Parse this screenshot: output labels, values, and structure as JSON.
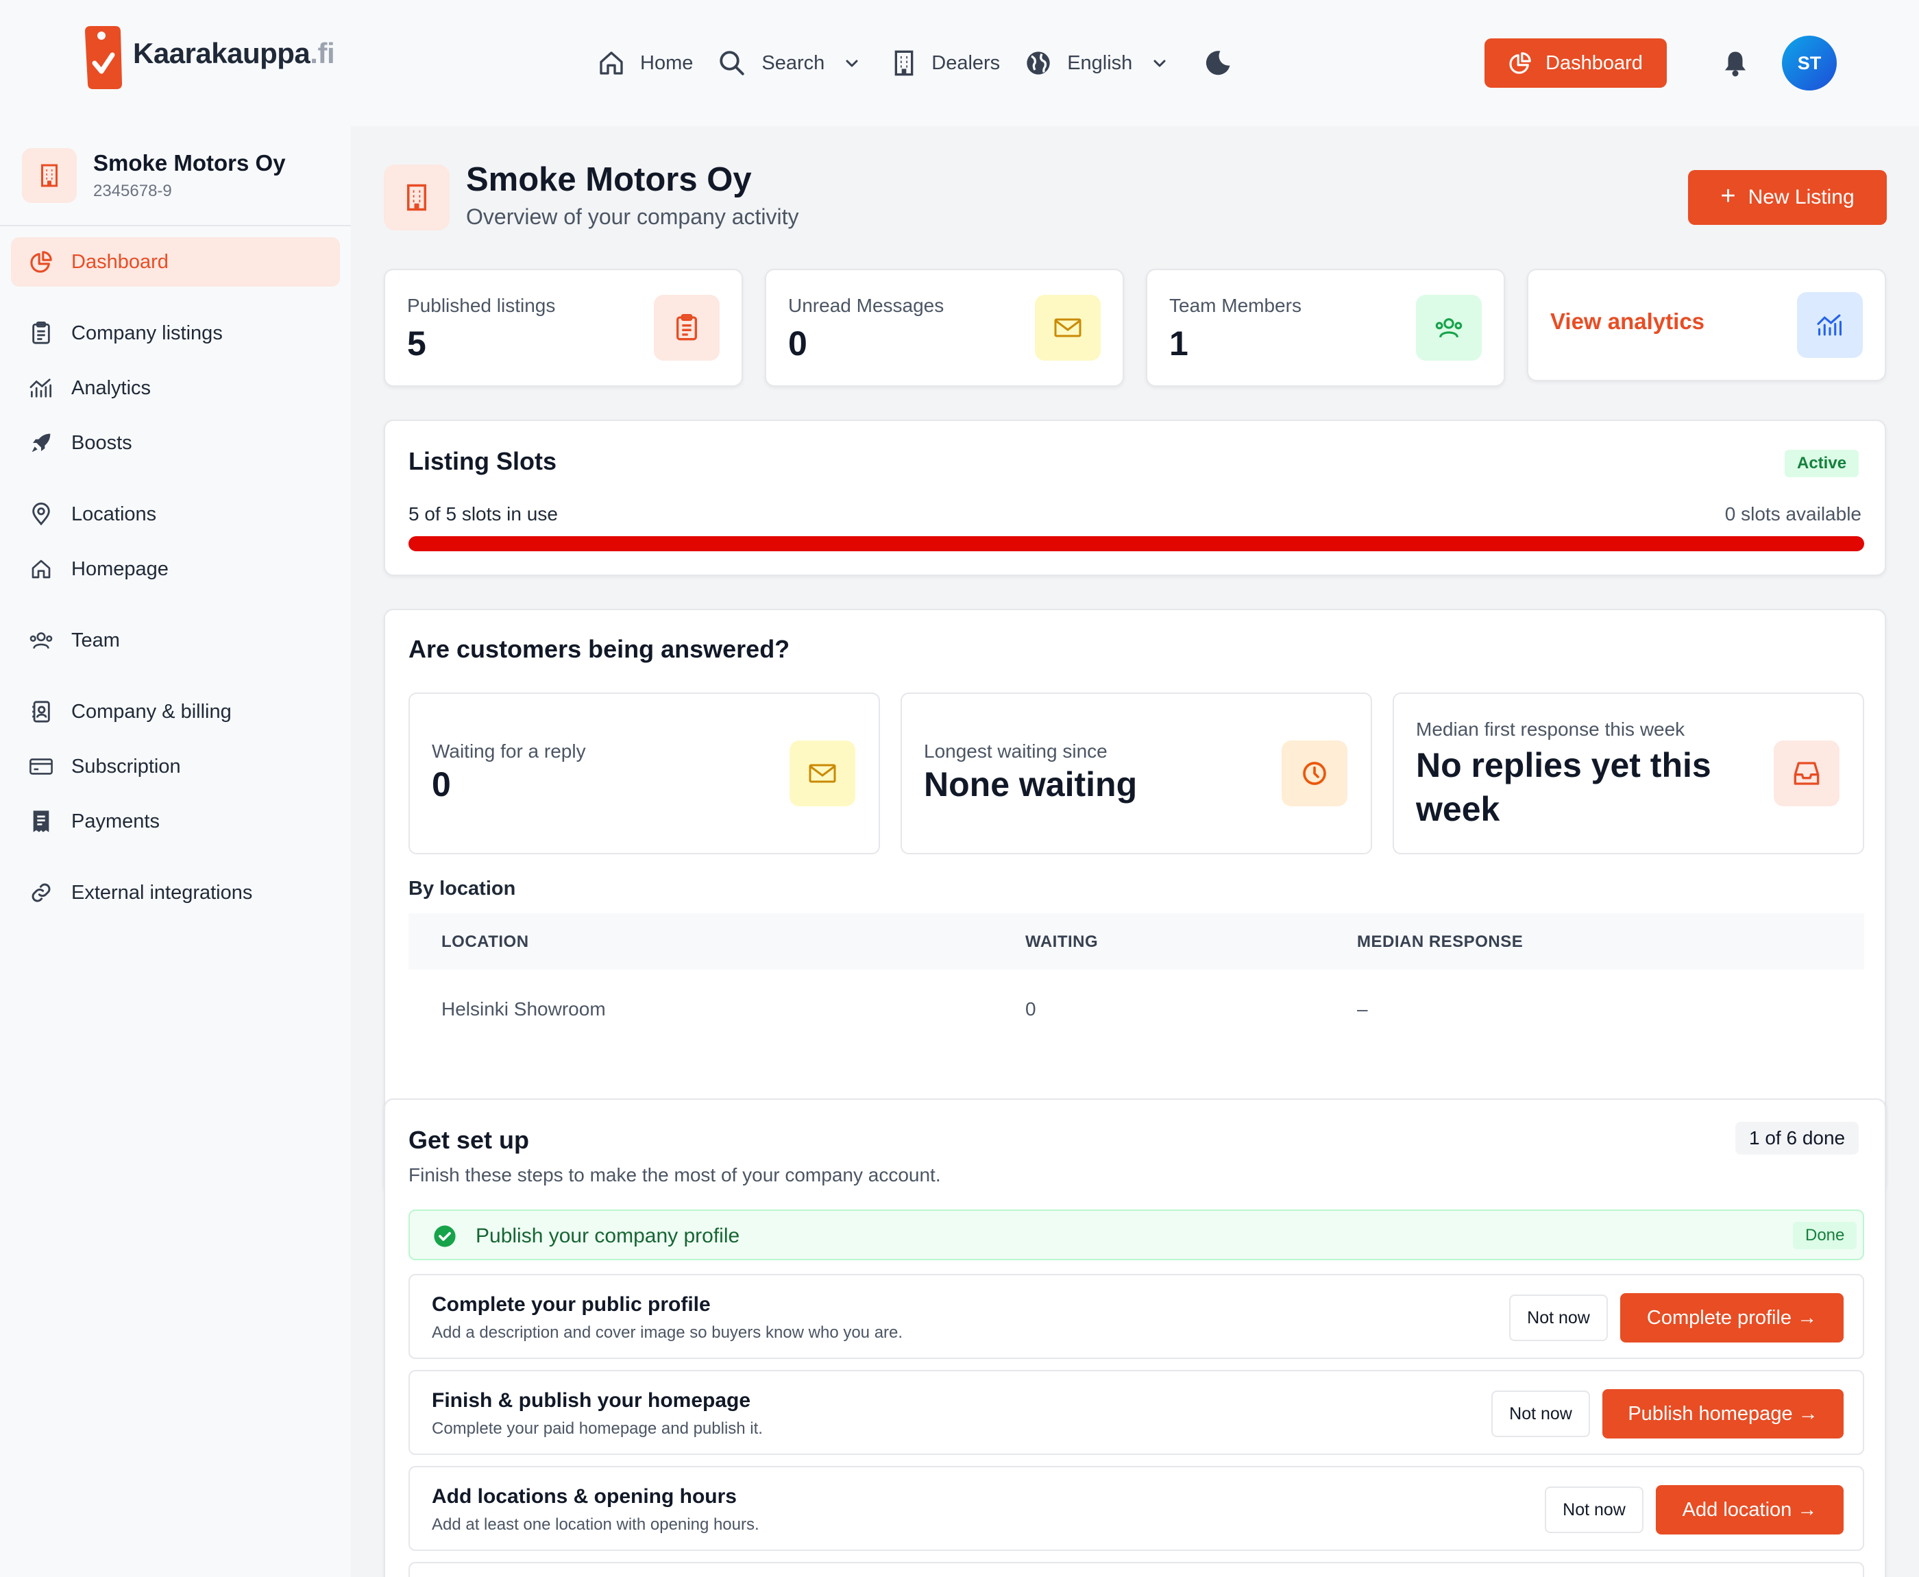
{
  "header": {
    "logo": {
      "name": "Kaarakauppa",
      "tld": ".fi"
    },
    "nav": [
      {
        "label": "Home",
        "icon": "home-icon"
      },
      {
        "label": "Search",
        "icon": "search-icon"
      },
      {
        "label": "Dealers",
        "icon": "building-icon"
      },
      {
        "label": "English",
        "icon": "globe-icon"
      }
    ],
    "dashboard_label": "Dashboard",
    "avatar_initials": "ST"
  },
  "sidebar": {
    "company_name": "Smoke Motors Oy",
    "company_id": "2345678-9",
    "items": [
      {
        "label": "Dashboard",
        "icon": "pie-chart-icon",
        "active": true
      },
      {
        "label": "Company listings",
        "icon": "clipboard-icon"
      },
      {
        "label": "Analytics",
        "icon": "analytics-icon"
      },
      {
        "label": "Boosts",
        "icon": "rocket-icon"
      },
      {
        "label": "Locations",
        "icon": "map-pin-icon"
      },
      {
        "label": "Homepage",
        "icon": "home-icon"
      },
      {
        "label": "Team",
        "icon": "users-icon"
      },
      {
        "label": "Company & billing",
        "icon": "contact-book-icon"
      },
      {
        "label": "Subscription",
        "icon": "credit-card-icon"
      },
      {
        "label": "Payments",
        "icon": "receipt-icon"
      },
      {
        "label": "External integrations",
        "icon": "link-icon"
      }
    ]
  },
  "main": {
    "title": "Smoke Motors Oy",
    "subtitle": "Overview of your company activity",
    "new_listing_label": "New Listing",
    "stats": [
      {
        "label": "Published listings",
        "value": "5",
        "icon": "clipboard-icon"
      },
      {
        "label": "Unread Messages",
        "value": "0",
        "icon": "mail-icon"
      },
      {
        "label": "Team Members",
        "value": "1",
        "icon": "users-icon"
      }
    ],
    "analytics_link": "View analytics",
    "slots": {
      "title": "Listing Slots",
      "status": "Active",
      "in_use": "5 of 5 slots in use",
      "available": "0 slots available",
      "used_fraction": 1.0
    },
    "response": {
      "title": "Are customers being answered?",
      "cards": [
        {
          "label": "Waiting for a reply",
          "value": "0",
          "icon": "mail-icon"
        },
        {
          "label": "Longest waiting since",
          "value": "None waiting",
          "icon": "clock-icon"
        },
        {
          "label": "Median first response this week",
          "value": "No replies yet this week",
          "icon": "inbox-icon"
        }
      ],
      "by_location_label": "By location",
      "columns": [
        "LOCATION",
        "WAITING",
        "MEDIAN RESPONSE"
      ],
      "rows": [
        {
          "location": "Helsinki Showroom",
          "waiting": "0",
          "median": "–"
        }
      ]
    },
    "setup": {
      "title": "Get set up",
      "progress": "1 of 6 done",
      "subtitle": "Finish these steps to make the most of your company account.",
      "done_step": {
        "label": "Publish your company profile",
        "badge": "Done"
      },
      "steps": [
        {
          "title": "Complete your public profile",
          "desc": "Add a description and cover image so buyers know who you are.",
          "skip": "Not now",
          "cta": "Complete profile →"
        },
        {
          "title": "Finish & publish your homepage",
          "desc": "Complete your paid homepage and publish it.",
          "skip": "Not now",
          "cta": "Publish homepage →"
        },
        {
          "title": "Add locations & opening hours",
          "desc": "Add at least one location with opening hours.",
          "skip": "Not now",
          "cta": "Add location →"
        }
      ]
    }
  },
  "colors": {
    "accent": "#e84d24",
    "slot_bar": "#e10600",
    "success": "#15803d"
  }
}
